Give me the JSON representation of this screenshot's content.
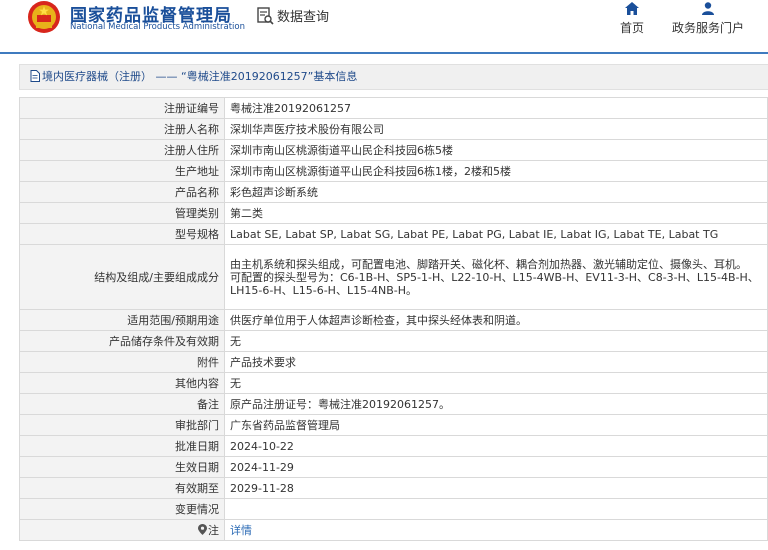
{
  "header": {
    "brand_cn": "国家药品监督管理局",
    "brand_en": "National Medical Products Administration",
    "search_label": "数据查询",
    "nav": [
      {
        "label": "首页",
        "icon": "home-icon"
      },
      {
        "label": "政务服务门户",
        "icon": "user-icon"
      }
    ]
  },
  "breadcrumb": {
    "section": "境内医疗器械（注册）",
    "separator": "——",
    "title": "“粤械注准20192061257”基本信息"
  },
  "colors": {
    "brand_blue": "#1a4f9a",
    "link_blue": "#2a6ab5",
    "label_bg": "#f3f3f3"
  },
  "rows": [
    {
      "label": "注册证编号",
      "value": "粤械注准20192061257"
    },
    {
      "label": "注册人名称",
      "value": "深圳华声医疗技术股份有限公司"
    },
    {
      "label": "注册人住所",
      "value": "深圳市南山区桃源街道平山民企科技园6栋5楼"
    },
    {
      "label": "生产地址",
      "value": "深圳市南山区桃源街道平山民企科技园6栋1楼，2楼和5楼"
    },
    {
      "label": "产品名称",
      "value": "彩色超声诊断系统"
    },
    {
      "label": "管理类别",
      "value": "第二类"
    },
    {
      "label": "型号规格",
      "value": "Labat SE, Labat SP, Labat SG, Labat PE, Labat PG, Labat IE, Labat IG, Labat TE, Labat TG"
    },
    {
      "label": "结构及组成/主要组成成分",
      "value": "由主机系统和探头组成，可配置电池、脚踏开关、磁化杯、耦合剂加热器、激光辅助定位、摄像头、耳机。",
      "value2": "可配置的探头型号为：C6-1B-H、SP5-1-H、L22-10-H、L15-4WB-H、EV11-3-H、C8-3-H、L15-4B-H、LH15-6-H、L15-6-H、L15-4NB-H。"
    },
    {
      "label": "适用范围/预期用途",
      "value": "供医疗单位用于人体超声诊断检查，其中探头经体表和阴道。"
    },
    {
      "label": "产品储存条件及有效期",
      "value": "无"
    },
    {
      "label": "附件",
      "value": "产品技术要求"
    },
    {
      "label": "其他内容",
      "value": "无"
    },
    {
      "label": "备注",
      "value": "原产品注册证号：粤械注准20192061257。"
    },
    {
      "label": "审批部门",
      "value": "广东省药品监督管理局"
    },
    {
      "label": "批准日期",
      "value": "2024-10-22"
    },
    {
      "label": "生效日期",
      "value": "2024-11-29"
    },
    {
      "label": "有效期至",
      "value": "2029-11-28"
    },
    {
      "label": "变更情况",
      "value": ""
    },
    {
      "label": "注",
      "value": "详情"
    }
  ]
}
